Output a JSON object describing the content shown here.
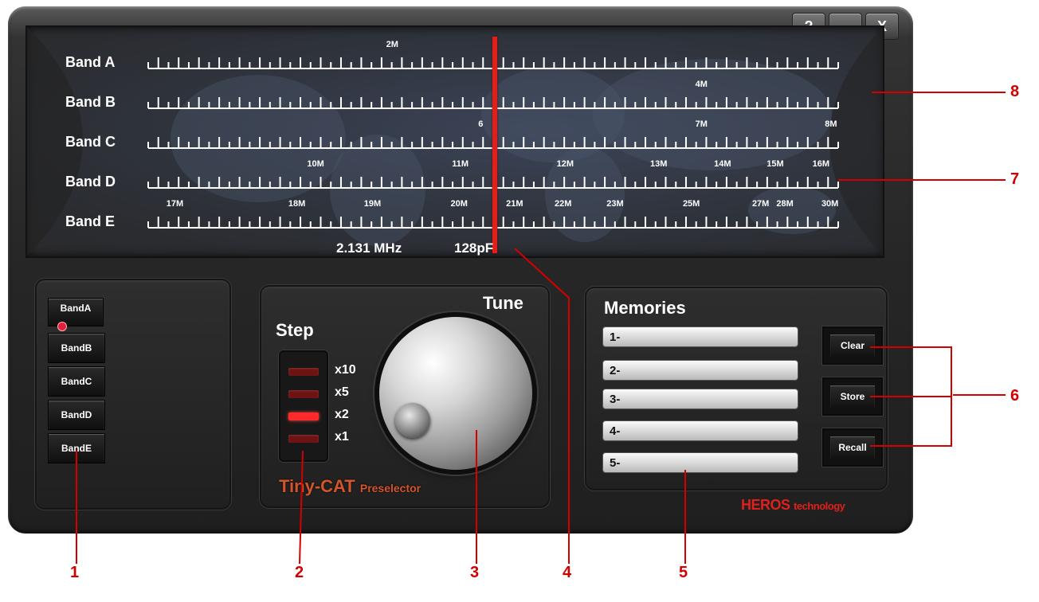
{
  "window": {
    "help_label": "?",
    "minimize_label": "—",
    "close_label": "X"
  },
  "dial": {
    "bands": [
      {
        "label": "Band A",
        "freq_marks": [
          {
            "text": "2M",
            "pos": 0.357
          }
        ]
      },
      {
        "label": "Band B",
        "freq_marks": [
          {
            "text": "4M",
            "pos": 0.803
          }
        ]
      },
      {
        "label": "Band C",
        "freq_marks": [
          {
            "text": "6",
            "pos": 0.49
          },
          {
            "text": "7M",
            "pos": 0.803
          },
          {
            "text": "8M",
            "pos": 0.99
          }
        ]
      },
      {
        "label": "Band D",
        "freq_marks": [
          {
            "text": "10M",
            "pos": 0.243
          },
          {
            "text": "11M",
            "pos": 0.452
          },
          {
            "text": "12M",
            "pos": 0.603
          },
          {
            "text": "13M",
            "pos": 0.738
          },
          {
            "text": "14M",
            "pos": 0.83
          },
          {
            "text": "15M",
            "pos": 0.906
          },
          {
            "text": "16M",
            "pos": 0.972
          }
        ]
      },
      {
        "label": "Band E",
        "freq_marks": [
          {
            "text": "17M",
            "pos": 0.04
          },
          {
            "text": "18M",
            "pos": 0.216
          },
          {
            "text": "19M",
            "pos": 0.325
          },
          {
            "text": "20M",
            "pos": 0.45
          },
          {
            "text": "21M",
            "pos": 0.53
          },
          {
            "text": "22M",
            "pos": 0.6
          },
          {
            "text": "23M",
            "pos": 0.675
          },
          {
            "text": "25M",
            "pos": 0.785
          },
          {
            "text": "27M",
            "pos": 0.885
          },
          {
            "text": "28M",
            "pos": 0.92
          },
          {
            "text": "30M",
            "pos": 0.985
          }
        ]
      }
    ],
    "frequency": "2.131 MHz",
    "capacitance": "128pF"
  },
  "bands_panel": {
    "buttons": [
      "BandA",
      "BandB",
      "BandC",
      "BandD",
      "BandE"
    ],
    "selected": "BandA"
  },
  "tuning_panel": {
    "step_title": "Step",
    "tune_title": "Tune",
    "steps": [
      {
        "label": "x10",
        "active": false
      },
      {
        "label": "x5",
        "active": false
      },
      {
        "label": "x2",
        "active": true
      },
      {
        "label": "x1",
        "active": false
      }
    ],
    "brand_main": "Tiny-CAT",
    "brand_sub": "Preselector"
  },
  "memories_panel": {
    "title": "Memories",
    "slots": [
      "1-",
      "2-",
      "3-",
      "4-",
      "5-"
    ],
    "clear_label": "Clear",
    "store_label": "Store",
    "recall_label": "Recall"
  },
  "footer": {
    "brand_main": "HEROS",
    "brand_sub": "technology"
  },
  "callouts": [
    "1",
    "2",
    "3",
    "4",
    "5",
    "6",
    "7",
    "8"
  ],
  "colors": {
    "needle": "#e0201a",
    "led_on": "#ff2a2a",
    "led_off": "#6e1313",
    "callout": "#d40000",
    "brand_orange": "#d4552a"
  }
}
